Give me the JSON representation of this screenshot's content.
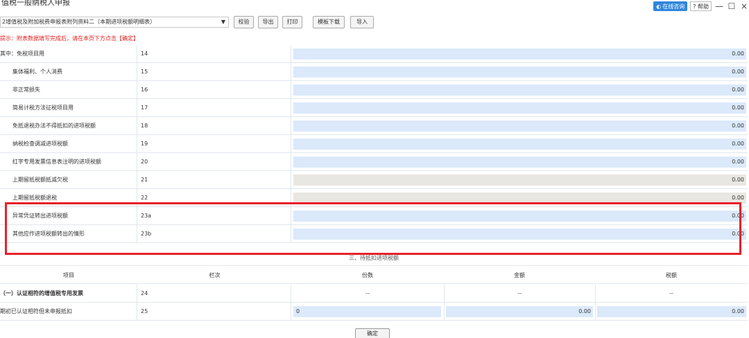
{
  "window": {
    "title": "值税一般纳税人申报",
    "online_label": "在线咨询",
    "help_label": "? 帮助",
    "minimize": "—",
    "maximize": "☐",
    "close": "×"
  },
  "toolbar": {
    "form_select_value": "2增值税及附加税费申报表附列资料二（本期进项税额明细表）",
    "buttons": [
      "校验",
      "导出",
      "打印",
      "模板下载",
      "导入"
    ]
  },
  "hint": "提示：附表数据填写完成后，请在本页下方点击【确定】",
  "rows": [
    {
      "name": "其中：免税项目用",
      "num": "14",
      "value": "0.00"
    },
    {
      "name": "集体福利、个人消费",
      "num": "15",
      "value": "0.00"
    },
    {
      "name": "非正常损失",
      "num": "16",
      "value": "0.00"
    },
    {
      "name": "简易计税方法征税项目用",
      "num": "17",
      "value": "0.00"
    },
    {
      "name": "免抵退税办法不得抵扣的进项税额",
      "num": "18",
      "value": "0.00"
    },
    {
      "name": "纳税检查调减进项税额",
      "num": "19",
      "value": "0.00"
    },
    {
      "name": "红字专用发票信息表注明的进项税额",
      "num": "20",
      "value": "0.00"
    },
    {
      "name": "上期留抵税额抵减欠税",
      "num": "21",
      "value": "0.00"
    },
    {
      "name": "上期留抵税额退税",
      "num": "22",
      "value": "0.00"
    },
    {
      "name": "异常凭证转出进项税额",
      "num": "23a",
      "value": "0.00"
    },
    {
      "name": "其他应作进项税额转出的情形",
      "num": "23b",
      "value": "0.00"
    }
  ],
  "section3": {
    "title": "三、待抵扣进项税额",
    "headers": [
      "项目",
      "栏次",
      "份数",
      "金额",
      "税额"
    ],
    "row24": {
      "name": "（一）认证相符的增值税专用发票",
      "num": "24",
      "c1": "--",
      "c2": "--",
      "c3": "--"
    },
    "row25": {
      "name": "期初已认证相符但未申报抵扣",
      "num": "25",
      "c1": "0",
      "c2": "0.00",
      "c3": "0.00"
    }
  },
  "confirm_label": "确定",
  "colors": {
    "accent": "#2e86de",
    "highlight": "#e8202a",
    "input_bg": "#dbe9fb",
    "hint": "#e02020"
  }
}
